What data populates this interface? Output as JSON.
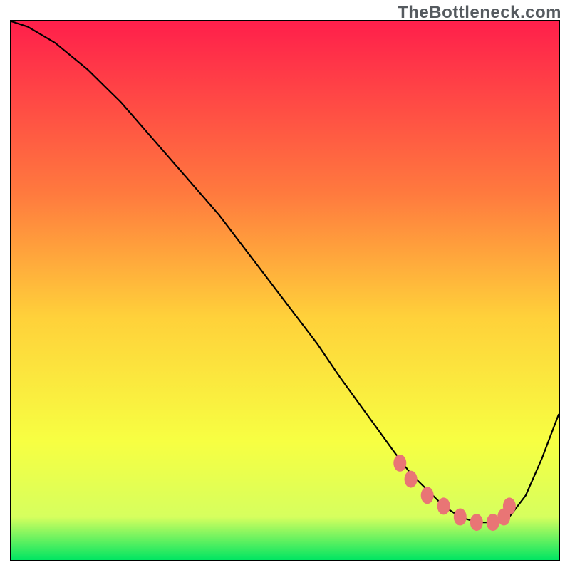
{
  "watermark": "TheBottleneck.com",
  "colors": {
    "gradient_top": "#ff1f4b",
    "gradient_mid_upper": "#ff7a3e",
    "gradient_mid": "#ffd13a",
    "gradient_mid_lower": "#f7ff42",
    "gradient_low": "#d6ff5e",
    "gradient_bottom": "#00e562",
    "curve": "#000000",
    "marker": "#e97575",
    "frame": "#000000"
  },
  "chart_data": {
    "type": "line",
    "title": "",
    "xlabel": "",
    "ylabel": "",
    "xlim": [
      0,
      100
    ],
    "ylim": [
      0,
      100
    ],
    "series": [
      {
        "name": "bottleneck-curve",
        "x": [
          0,
          3,
          8,
          14,
          20,
          26,
          32,
          38,
          44,
          50,
          56,
          60,
          65,
          70,
          73,
          76,
          79,
          82,
          85,
          88,
          91,
          94,
          97,
          100
        ],
        "values": [
          100,
          99,
          96,
          91,
          85,
          78,
          71,
          64,
          56,
          48,
          40,
          34,
          27,
          20,
          16,
          13,
          10,
          8,
          7,
          7,
          8,
          12,
          19,
          27
        ]
      }
    ],
    "markers": {
      "name": "highlighted-range",
      "x": [
        71,
        73,
        76,
        79,
        82,
        85,
        88,
        90,
        91
      ],
      "values": [
        18,
        15,
        12,
        10,
        8,
        7,
        7,
        8,
        10
      ]
    }
  }
}
